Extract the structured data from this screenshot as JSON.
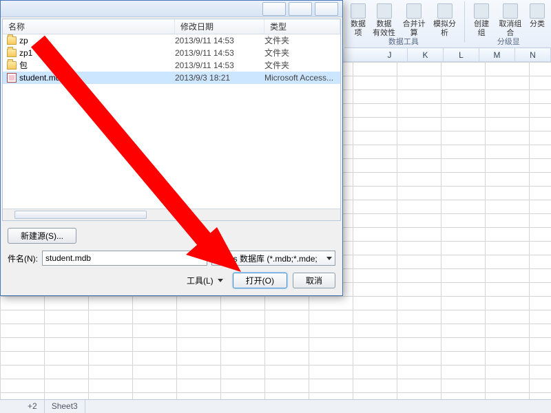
{
  "ribbon": {
    "btn_data": "数据",
    "btn_validation": "数据\n有效性",
    "btn_consolidate": "合并计算",
    "btn_whatif": "模拟分析",
    "btn_group": "创建组",
    "btn_ungroup": "取消组合",
    "btn_subtotal": "分类",
    "group_tools": "数据工具",
    "group_outline": "分级显",
    "option_label": "项"
  },
  "columns": [
    "J",
    "K",
    "L",
    "M",
    "N"
  ],
  "sheettabs": {
    "s2": "+2",
    "s3": "Sheet3"
  },
  "dialog": {
    "headers": {
      "name": "名称",
      "date": "修改日期",
      "type": "类型"
    },
    "files": [
      {
        "icon": "folder",
        "name": "zp",
        "date": "2013/9/11 14:53",
        "type": "文件夹",
        "selected": false
      },
      {
        "icon": "folder",
        "name": "zp1",
        "date": "2013/9/11 14:53",
        "type": "文件夹",
        "selected": false
      },
      {
        "icon": "folder",
        "name": "包",
        "date": "2013/9/11 14:53",
        "type": "文件夹",
        "selected": false
      },
      {
        "icon": "mdb",
        "name": "student.mdb",
        "date": "2013/9/3 18:21",
        "type": "Microsoft Access...",
        "selected": true
      }
    ],
    "new_source": "新建源(S)...",
    "filename_label": "件名(N):",
    "filename_value": "student.mdb",
    "filter": "ccess 数据库 (*.mdb;*.mde;",
    "tools": "工具(L)",
    "open": "打开(O)",
    "cancel": "取消"
  }
}
